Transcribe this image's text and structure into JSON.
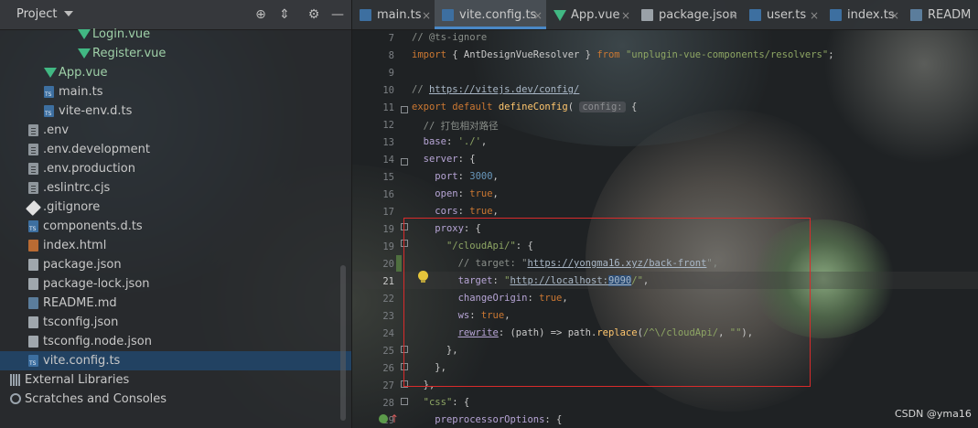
{
  "project_panel": {
    "title": "Project",
    "items": [
      {
        "label": "Login.vue",
        "type": "vue",
        "indent": 2
      },
      {
        "label": "Register.vue",
        "type": "vue",
        "indent": 2
      },
      {
        "label": "App.vue",
        "type": "vue",
        "indent": 1
      },
      {
        "label": "main.ts",
        "type": "ts",
        "indent": 1
      },
      {
        "label": "vite-env.d.ts",
        "type": "ts",
        "indent": 1
      },
      {
        "label": ".env",
        "type": "file",
        "indent": 0
      },
      {
        "label": ".env.development",
        "type": "file",
        "indent": 0
      },
      {
        "label": ".env.production",
        "type": "file",
        "indent": 0
      },
      {
        "label": ".eslintrc.cjs",
        "type": "file",
        "indent": 0
      },
      {
        "label": ".gitignore",
        "type": "git",
        "indent": 0
      },
      {
        "label": "components.d.ts",
        "type": "ts",
        "indent": 0
      },
      {
        "label": "index.html",
        "type": "html",
        "indent": 0
      },
      {
        "label": "package.json",
        "type": "json",
        "indent": 0
      },
      {
        "label": "package-lock.json",
        "type": "json",
        "indent": 0
      },
      {
        "label": "README.md",
        "type": "md",
        "indent": 0
      },
      {
        "label": "tsconfig.json",
        "type": "json",
        "indent": 0
      },
      {
        "label": "tsconfig.node.json",
        "type": "json",
        "indent": 0
      },
      {
        "label": "vite.config.ts",
        "type": "ts",
        "indent": 0,
        "selected": true
      },
      {
        "label": "External Libraries",
        "type": "lib",
        "indent": -1
      },
      {
        "label": "Scratches and Consoles",
        "type": "scratch",
        "indent": -1
      }
    ]
  },
  "tabs": [
    {
      "label": "main.ts",
      "type": "ts"
    },
    {
      "label": "vite.config.ts",
      "type": "ts",
      "active": true
    },
    {
      "label": "App.vue",
      "type": "vue"
    },
    {
      "label": "package.json",
      "type": "json"
    },
    {
      "label": "user.ts",
      "type": "ts"
    },
    {
      "label": "index.ts",
      "type": "ts"
    },
    {
      "label": "READM",
      "type": "md"
    }
  ],
  "editor": {
    "current_line": 21,
    "lines": [
      {
        "n": 7,
        "html": "<span class=\"c-cmt\">// @ts-ignore</span>"
      },
      {
        "n": 8,
        "html": "<span class=\"c-kw\">import</span> { AntDesignVueResolver } <span class=\"c-kw\">from</span> <span class=\"c-str\">\"unplugin-vue-components/resolvers\"</span>;"
      },
      {
        "n": 9,
        "html": ""
      },
      {
        "n": 10,
        "html": "<span class=\"c-cmt\">// <span class=\"c-link\">https://vitejs.dev/config/</span></span>"
      },
      {
        "n": 11,
        "html": "<span class=\"c-kw\">export default</span> <span class=\"c-fn\">defineConfig</span>( <span class=\"c-hint\">config:</span> {"
      },
      {
        "n": 12,
        "html": "  <span class=\"c-cmt\">// 打包相对路径</span>"
      },
      {
        "n": 13,
        "html": "  <span class=\"c-key\">base</span>: <span class=\"c-str\">'./'</span>,"
      },
      {
        "n": 14,
        "html": "  <span class=\"c-key\">server</span>: {"
      },
      {
        "n": 15,
        "html": "    <span class=\"c-key\">port</span>: <span class=\"c-num\">3000</span>,"
      },
      {
        "n": 16,
        "html": "    <span class=\"c-key\">open</span>: <span class=\"c-kw\">true</span>,"
      },
      {
        "n": 17,
        "html": "    <span class=\"c-key\">cors</span>: <span class=\"c-kw\">true</span>,"
      },
      {
        "n": 19,
        "html": "    <span class=\"c-key\">proxy</span>: {"
      },
      {
        "n": 19,
        "html": "      <span class=\"c-str\">\"/cloudApi/\"</span>: {"
      },
      {
        "n": 20,
        "html": "        <span class=\"c-cmt\">// target: \"<span class=\"c-link\">https://yongma16.xyz/back-front</span>\",</span>"
      },
      {
        "n": 21,
        "html": "        <span class=\"c-key\">target</span>: <span class=\"c-str\">\"<span class=\"c-link\">http://localhost:<span class=\"c-sel\">9090</span></span>/\"</span>,"
      },
      {
        "n": 22,
        "html": "        <span class=\"c-key\">changeOrigin</span>: <span class=\"c-kw\">true</span>,"
      },
      {
        "n": 23,
        "html": "        <span class=\"c-key\">ws</span>: <span class=\"c-kw\">true</span>,"
      },
      {
        "n": 24,
        "html": "        <span class=\"c-key\" style=\"text-decoration:underline\">rewrite</span>: (path) => path.<span class=\"c-fn\">replace</span>(<span class=\"c-str\">/^\\/cloudApi/</span>, <span class=\"c-str\">\"\"</span>),"
      },
      {
        "n": 25,
        "html": "      },"
      },
      {
        "n": 26,
        "html": "    },"
      },
      {
        "n": 27,
        "html": "  },"
      },
      {
        "n": 28,
        "html": "  <span class=\"c-str\">\"css\"</span>: {"
      },
      {
        "n": 29,
        "html": "    <span class=\"c-key\">preprocessorOptions</span>: {"
      }
    ]
  },
  "watermark": "CSDN @yma16"
}
